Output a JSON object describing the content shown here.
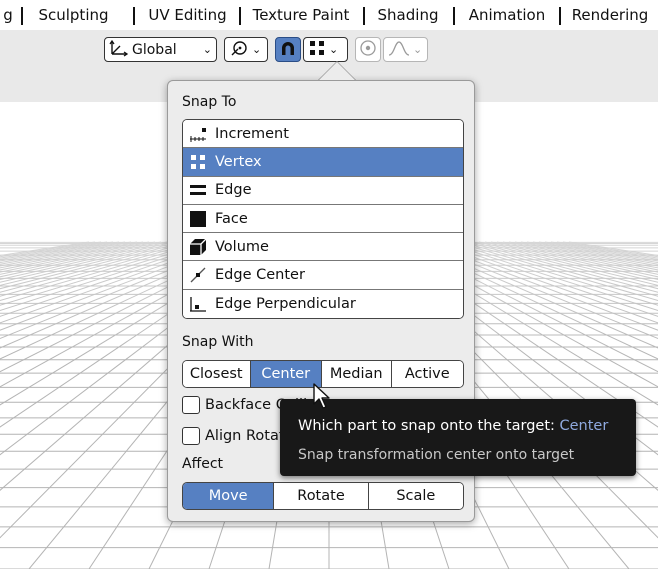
{
  "workspace_tabs": [
    "g",
    "Sculpting",
    "UV Editing",
    "Texture Paint",
    "Shading",
    "Animation",
    "Rendering"
  ],
  "toolbar": {
    "orientation_label": "Global",
    "orientation_icon": "transform-orientation-icon",
    "pivot_icon": "pivot-point-icon",
    "snap_toggle_icon": "magnet-icon",
    "snap_target_icon": "vertex-snap-icon",
    "proportional_icon": "proportional-edit-icon",
    "falloff_icon": "falloff-curve-icon"
  },
  "popover": {
    "snap_to_label": "Snap To",
    "snap_to_items": [
      {
        "label": "Increment",
        "icon": "increment-icon",
        "selected": false
      },
      {
        "label": "Vertex",
        "icon": "vertex-icon",
        "selected": true
      },
      {
        "label": "Edge",
        "icon": "edge-icon",
        "selected": false
      },
      {
        "label": "Face",
        "icon": "face-icon",
        "selected": false
      },
      {
        "label": "Volume",
        "icon": "volume-icon",
        "selected": false
      },
      {
        "label": "Edge Center",
        "icon": "edge-center-icon",
        "selected": false
      },
      {
        "label": "Edge Perpendicular",
        "icon": "edge-perpendicular-icon",
        "selected": false
      }
    ],
    "snap_with_label": "Snap With",
    "snap_with_options": [
      "Closest",
      "Center",
      "Median",
      "Active"
    ],
    "snap_with_selected": "Center",
    "backface_culling_label": "Backface Culling",
    "backface_culling_checked": false,
    "align_rotation_label": "Align Rotation to Target",
    "align_rotation_checked": false,
    "affect_label": "Affect",
    "affect_options": [
      "Move",
      "Rotate",
      "Scale"
    ],
    "affect_selected": "Move"
  },
  "tooltip": {
    "title": "Which part to snap onto the target:",
    "value": "Center",
    "description": "Snap transformation center onto target"
  },
  "colors": {
    "accent": "#5680c2",
    "tooltip_bg": "#181818",
    "tooltip_value": "#8fa9df"
  }
}
